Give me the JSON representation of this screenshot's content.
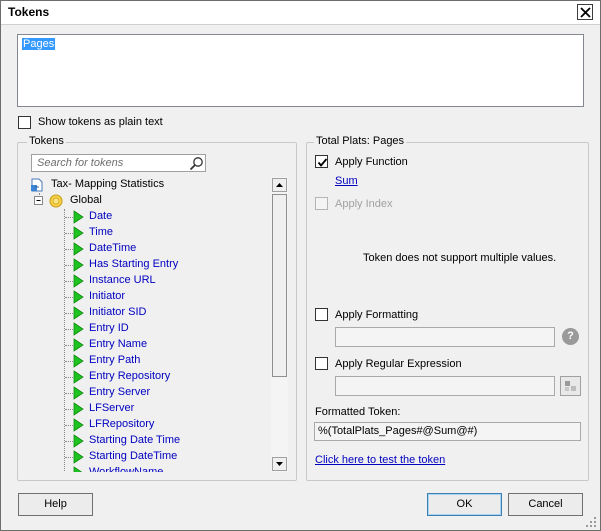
{
  "window": {
    "title": "Tokens"
  },
  "token_text": {
    "value": "Pages"
  },
  "show_plain_text": {
    "label": "Show tokens as plain text",
    "checked": false
  },
  "tokens_panel": {
    "title": "Tokens",
    "search_placeholder": "Search for tokens",
    "root": "Tax- Mapping Statistics",
    "group": "Global",
    "items": [
      "Date",
      "Time",
      "DateTime",
      "Has Starting Entry",
      "Instance URL",
      "Initiator",
      "Initiator SID",
      "Entry ID",
      "Entry Name",
      "Entry Path",
      "Entry Repository",
      "Entry Server",
      "LFServer",
      "LFRepository",
      "Starting Date Time",
      "Starting DateTime",
      "WorkflowName"
    ]
  },
  "options_panel": {
    "title": "Total Plats: Pages",
    "apply_function": {
      "label": "Apply Function",
      "checked": true,
      "link": "Sum"
    },
    "apply_index": {
      "label": "Apply Index",
      "checked": false,
      "disabled": true
    },
    "message": "Token does not support multiple values.",
    "apply_formatting": {
      "label": "Apply Formatting",
      "checked": false,
      "value": ""
    },
    "apply_regex": {
      "label": "Apply Regular Expression",
      "checked": false,
      "value": ""
    },
    "formatted_label": "Formatted Token:",
    "formatted_value": "%(TotalPlats_Pages#@Sum@#)",
    "test_link": "Click here to test the token"
  },
  "buttons": {
    "help": "Help",
    "ok": "OK",
    "cancel": "Cancel"
  },
  "icons": {
    "close": "close-icon",
    "search": "search-icon",
    "document": "document-icon",
    "folder": "folder-coin-icon",
    "token": "green-triangle-icon",
    "help": "question-mark-icon",
    "regex": "regex-builder-icon"
  },
  "colors": {
    "link": "#0000c0",
    "selection": "#3399ff",
    "token_arrow": "#1fc31f"
  }
}
